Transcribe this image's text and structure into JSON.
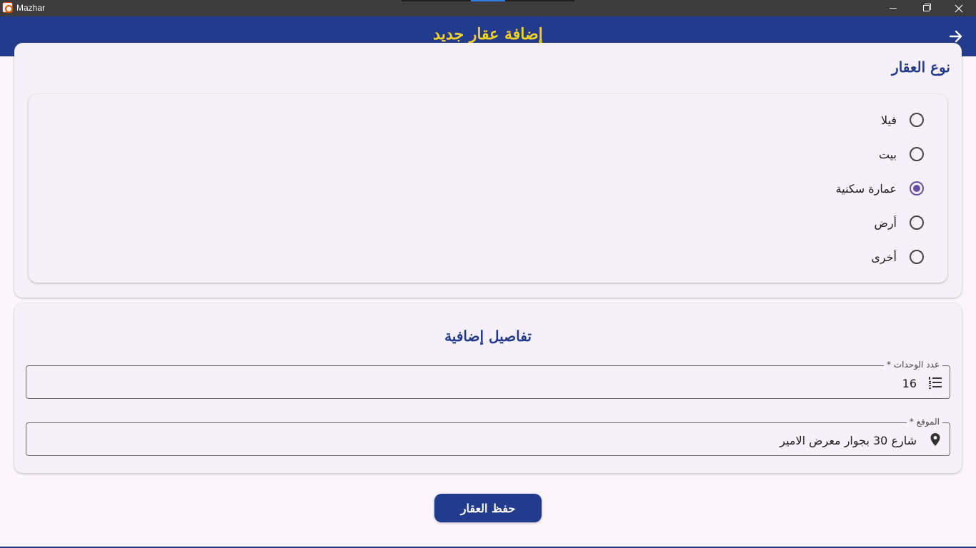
{
  "window": {
    "title": "Mazhar",
    "app_icon": "mazhar-app-icon",
    "controls": [
      "minimize-icon",
      "restore-icon",
      "close-icon"
    ]
  },
  "appbar": {
    "title": "إضافة عقار جديد",
    "back_icon": "arrow-forward-icon",
    "background": "#233b8c",
    "title_color": "#f5d322"
  },
  "property_type": {
    "heading": "نوع العقار",
    "options": [
      {
        "label": "فيلا",
        "selected": false
      },
      {
        "label": "بيت",
        "selected": false
      },
      {
        "label": "عمارة سكنية",
        "selected": true
      },
      {
        "label": "أرض",
        "selected": false
      },
      {
        "label": "أخرى",
        "selected": false
      }
    ],
    "selected_color": "#6750a4"
  },
  "details": {
    "heading": "تفاصيل إضافية",
    "units": {
      "label": "عدد الوحدات *",
      "value": "16",
      "icon": "list-numbered-icon"
    },
    "location": {
      "label": "الموقع *",
      "value": "شارع 30 بجوار معرض الامير",
      "icon": "location-pin-icon"
    }
  },
  "actions": {
    "save_label": "حفظ العقار"
  }
}
